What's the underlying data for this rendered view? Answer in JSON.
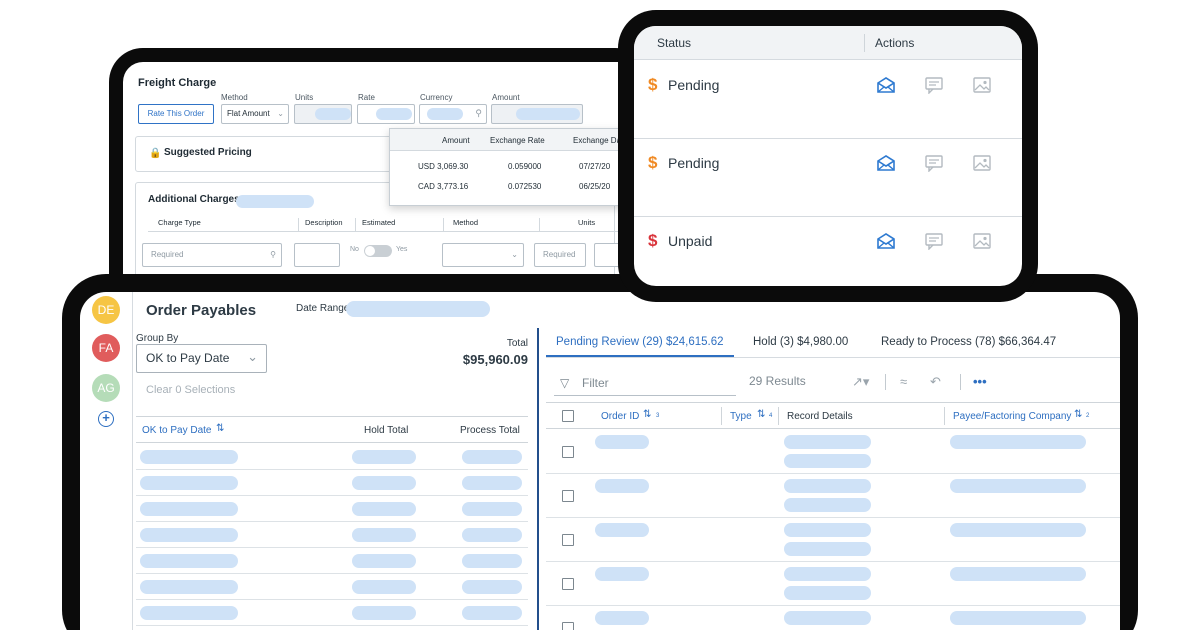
{
  "freight": {
    "title": "Freight Charge",
    "rate_button": "Rate This Order",
    "method_label": "Method",
    "method_value": "Flat Amount",
    "units_label": "Units",
    "rate_label": "Rate",
    "currency_label": "Currency",
    "amount_label": "Amount",
    "suggested_pricing": "Suggested Pricing",
    "additional_charges": "Additional Charges",
    "columns": [
      "Charge Type",
      "Description",
      "Estimated",
      "Method",
      "Units"
    ],
    "charge_type_placeholder": "Required",
    "units_placeholder": "Required",
    "estimated_no": "No",
    "estimated_yes": "Yes",
    "popup": {
      "headers": [
        "Amount",
        "Exchange Rate",
        "Exchange Da"
      ],
      "rows": [
        {
          "amount": "USD 3,069.30",
          "rate": "0.059000",
          "date": "07/27/20"
        },
        {
          "amount": "CAD 3,773.16",
          "rate": "0.072530",
          "date": "06/25/20"
        }
      ]
    }
  },
  "status_panel": {
    "status_header": "Status",
    "actions_header": "Actions",
    "rows": [
      {
        "status": "Pending",
        "color": "#f08a24"
      },
      {
        "status": "Pending",
        "color": "#f08a24"
      },
      {
        "status": "Unpaid",
        "color": "#d9343b"
      }
    ],
    "icons": [
      "envelope-open-icon",
      "comment-icon",
      "image-icon"
    ]
  },
  "payables": {
    "avatars": [
      {
        "initials": "DE",
        "color": "#f6c544"
      },
      {
        "initials": "FA",
        "color": "#e05c5c"
      },
      {
        "initials": "AG",
        "color": "#b5dcb8"
      }
    ],
    "title": "Order Payables",
    "date_range_label": "Date Range",
    "group_by_label": "Group By",
    "group_by_value": "OK to Pay Date",
    "total_label": "Total",
    "total_value": "$95,960.09",
    "clear_selections": "Clear 0 Selections",
    "left_columns": {
      "ok_to_pay": "OK to Pay Date",
      "hold_total": "Hold Total",
      "process_total": "Process Total"
    },
    "tabs": [
      {
        "label": "Pending Review (29) $24,615.62"
      },
      {
        "label": "Hold (3) $4,980.00"
      },
      {
        "label": "Ready to Process (78) $66,364.47"
      }
    ],
    "filter_label": "Filter",
    "results": "29 Results",
    "right_columns": {
      "order_id": "Order ID",
      "order_id_sort": "3",
      "type": "Type",
      "type_sort": "4",
      "record_details": "Record Details",
      "payee": "Payee/Factoring Company",
      "payee_sort": "2"
    },
    "brand_color": "#2e6fc1"
  }
}
